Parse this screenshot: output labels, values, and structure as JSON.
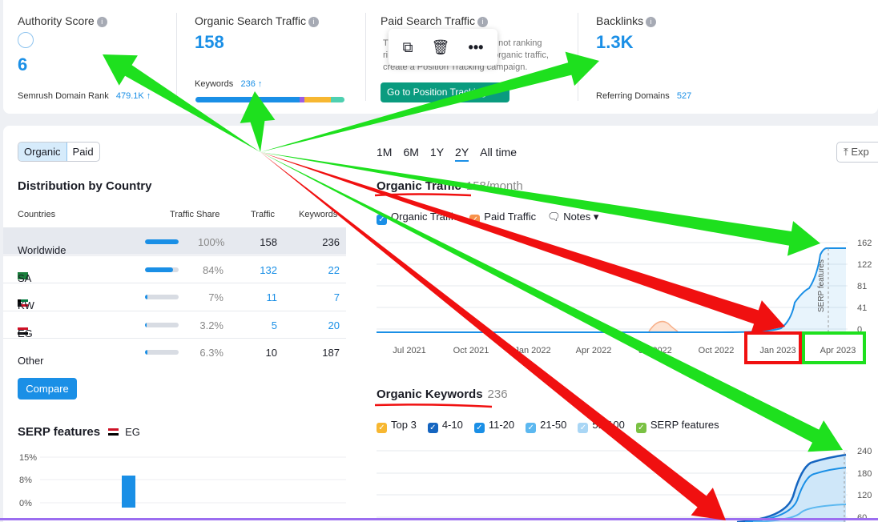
{
  "metrics": {
    "authority": {
      "label": "Authority Score",
      "value": "6",
      "foot_label": "Semrush Domain Rank",
      "foot_value": "479.1K ↑"
    },
    "organic": {
      "label": "Organic Search Traffic",
      "value": "158",
      "foot_label": "Keywords",
      "foot_value": "236 ↑"
    },
    "paid": {
      "label": "Paid Search Traffic",
      "note_lines": [
        "T",
        "ri",
        "create a Position Tracking campaign."
      ],
      "note_right": [
        "t not ranking",
        "organic traffic,"
      ],
      "button": "Go to Position Tracking"
    },
    "backlinks": {
      "label": "Backlinks",
      "value": "1.3K",
      "foot_label": "Referring Domains",
      "foot_value": "527"
    }
  },
  "popup": {
    "icons": [
      "copy-icon",
      "trash-icon",
      "more-icon"
    ]
  },
  "toggle": {
    "organic": "Organic",
    "paid": "Paid"
  },
  "distribution": {
    "title": "Distribution by Country",
    "headers": {
      "countries": "Countries",
      "share": "Traffic Share",
      "traffic": "Traffic",
      "keywords": "Keywords"
    },
    "rows": [
      {
        "country": "Worldwide",
        "share": "100%",
        "share_value": 1.0,
        "traffic": "158",
        "keywords": "236"
      },
      {
        "country": "SA",
        "share": "84%",
        "share_value": 0.84,
        "traffic": "132",
        "keywords": "22"
      },
      {
        "country": "KW",
        "share": "7%",
        "share_value": 0.07,
        "traffic": "11",
        "keywords": "7"
      },
      {
        "country": "EG",
        "share": "3.2%",
        "share_value": 0.032,
        "traffic": "5",
        "keywords": "20"
      },
      {
        "country": "Other",
        "share": "6.3%",
        "share_value": 0.063,
        "traffic": "10",
        "keywords": "187"
      }
    ]
  },
  "compare_label": "Compare",
  "serp": {
    "title": "SERP features",
    "flag_label": "EG",
    "yticks": [
      "15%",
      "8%",
      "0%"
    ]
  },
  "periods": [
    "1M",
    "6M",
    "1Y",
    "2Y",
    "All time"
  ],
  "active_period": "2Y",
  "export_label": "Exp",
  "traffic_chart": {
    "title": "Organic Traffic",
    "value": "158/month",
    "legend": [
      "Organic Traffic",
      "Paid Traffic",
      "Notes"
    ],
    "xticks": [
      "Jul 2021",
      "Oct 2021",
      "Jan 2022",
      "Apr 2022",
      "Jul 2022",
      "Oct 2022",
      "Jan 2023",
      "Apr 2023"
    ],
    "yticks": [
      "162",
      "122",
      "81",
      "41",
      "0"
    ],
    "side_label": "SERP features"
  },
  "keywords_chart": {
    "title": "Organic Keywords",
    "value": "236",
    "legend": [
      "Top 3",
      "4-10",
      "11-20",
      "21-50",
      "51-100",
      "SERP features"
    ],
    "yticks": [
      "240",
      "180",
      "120",
      "60"
    ]
  },
  "colors": {
    "accent": "#1a8fe6",
    "green_btn": "#0a9b7f",
    "arrow_green": "#1ee01e",
    "arrow_red": "#f01010"
  }
}
